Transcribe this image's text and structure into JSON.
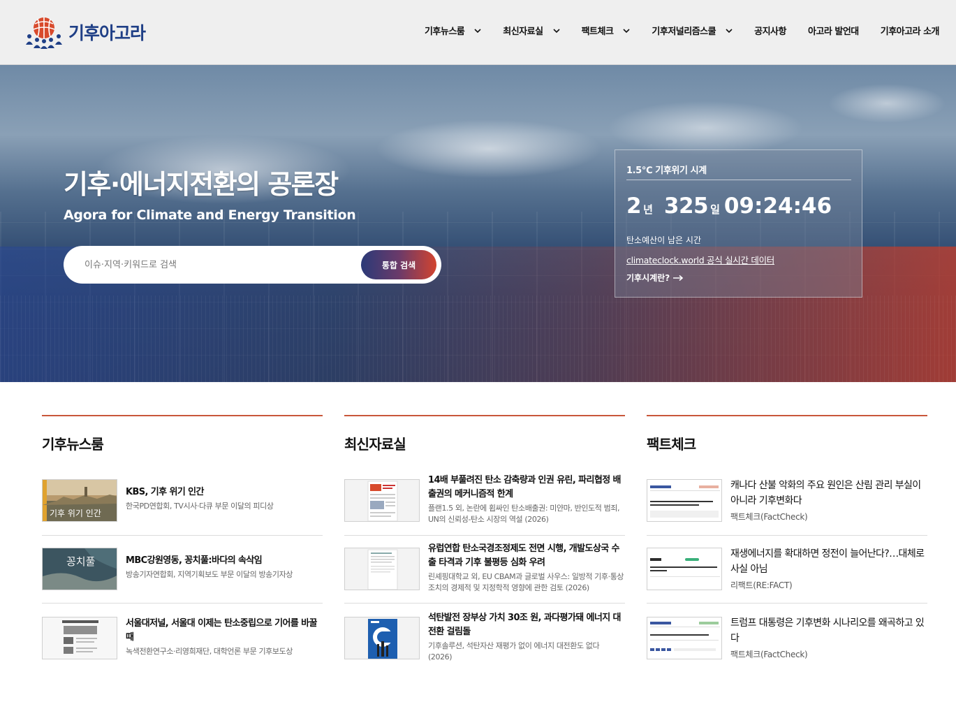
{
  "header": {
    "logo_text": "기후아고라",
    "nav": [
      {
        "label": "기후뉴스룸",
        "has_dropdown": true
      },
      {
        "label": "최신자료실",
        "has_dropdown": true
      },
      {
        "label": "팩트체크",
        "has_dropdown": true
      },
      {
        "label": "기후저널리즘스쿨",
        "has_dropdown": true
      },
      {
        "label": "공지사항",
        "has_dropdown": false
      },
      {
        "label": "아고라 발언대",
        "has_dropdown": false
      },
      {
        "label": "기후아고라 소개",
        "has_dropdown": false
      }
    ]
  },
  "hero": {
    "title": "기후·에너지전환의 공론장",
    "subtitle": "Agora for Climate and Energy Transition",
    "search_placeholder": "이슈·지역·키워드로 검색",
    "search_button": "통합 검색"
  },
  "clock": {
    "title": "1.5℃ 기후위기 시계",
    "years": "2",
    "years_unit": "년",
    "days": "325",
    "days_unit": "일",
    "hms": "09:24:46",
    "label": "탄소예산이 남은 시간",
    "source_link": "climateclock.world 공식 실시간 데이터",
    "more_link": "기후시계란?"
  },
  "sections": [
    {
      "title": "기후뉴스룸",
      "items": [
        {
          "title": "KBS, 기후 위기 인간",
          "meta": "한국PD연합회, TV시사·다큐 부문 이달의 피디상"
        },
        {
          "title": "MBC강원영동, 꽁치풀:바다의 속삭임",
          "meta": "방송기자연합회, 지역기획보도 부문 이달의 방송기자상"
        },
        {
          "title": "서울대저널, 서울대 이제는 탄소중립으로 기어를 바꿀 때",
          "meta": "녹색전환연구소·리영희재단, 대학언론 부문 기후보도상"
        }
      ]
    },
    {
      "title": "최신자료실",
      "items": [
        {
          "title": "14배 부풀려진 탄소 감축량과 인권 유린, 파리협정 배출권의 메커니즘적 한계",
          "meta": "플랜1.5 외, 논란에 휩싸인 탄소배출권: 미얀마, 반인도적 범죄, UN의 신뢰성-탄소 시장의 역설 (2026)"
        },
        {
          "title": "유럽연합 탄소국경조정제도 전면 시행, 개발도상국 수출 타격과 기후 불평등 심화 우려",
          "meta": "린셰핑대학교 외, EU CBAM과 글로벌 사우스: 일방적 기후·통상 조치의 경제적 및 지정학적 영향에 관한 검토 (2026)"
        },
        {
          "title": "석탄발전 장부상 가치 30조 원, 과다평가돼 에너지 대전환 걸림돌",
          "meta": "기후솔루션, 석탄자산 재평가 없이 에너지 대전환도 없다 (2026)"
        }
      ]
    },
    {
      "title": "팩트체크",
      "items": [
        {
          "title": "캐나다 산불 악화의 주요 원인은 산림 관리 부실이 아니라 기후변화다",
          "source": "팩트체크(FactCheck)"
        },
        {
          "title": "재생에너지를 확대하면 정전이 늘어난다?…대체로 사실 아님",
          "source": "리팩트(RE:FACT)"
        },
        {
          "title": "트럼프 대통령은 기후변화 시나리오를 왜곡하고 있다",
          "source": "팩트체크(FactCheck)"
        }
      ]
    }
  ],
  "thumb_text": {
    "kbs": "기후 위기 인간",
    "mbc": "꽁치풀"
  },
  "colors": {
    "accent": "#c9573a",
    "logo": "#1f3f86",
    "header_bg": "#efefef"
  }
}
